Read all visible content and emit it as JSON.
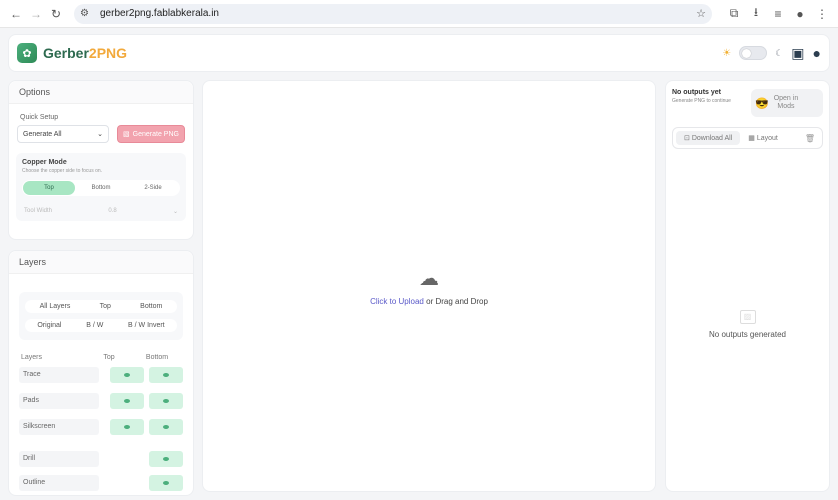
{
  "browser": {
    "url": "gerber2png.fablabkerala.in"
  },
  "app": {
    "brand_left": "Gerber",
    "brand_mid": "2",
    "brand_right": "PNG"
  },
  "options": {
    "title": "Options",
    "quick_setup_label": "Quick Setup",
    "quick_setup_value": "Generate All",
    "generate_btn": "Generate PNG",
    "copper_mode_title": "Copper Mode",
    "copper_mode_sub": "Choose the copper side to focus on.",
    "copper_tabs": [
      "Top",
      "Bottom",
      "2-Side"
    ],
    "tool_width_label": "Tool Width",
    "tool_width_value": "0.8"
  },
  "layers": {
    "title": "Layers",
    "filter_row1": [
      "All Layers",
      "Top",
      "Bottom"
    ],
    "filter_row2": [
      "Original",
      "B / W",
      "B / W Invert"
    ],
    "header": {
      "name": "Layers",
      "top": "Top",
      "bottom": "Bottom"
    },
    "rows": [
      {
        "name": "Trace"
      },
      {
        "name": "Pads"
      },
      {
        "name": "Silkscreen"
      },
      {
        "name": "Drill"
      },
      {
        "name": "Outline"
      }
    ]
  },
  "upload": {
    "link": "Click to Upload",
    "rest": " or Drag and Drop"
  },
  "outputs": {
    "title": "No outputs yet",
    "sub": "Generate PNG to continue",
    "mods_btn_line1": "Open in",
    "mods_btn_line2": "Mods",
    "download_all": "Download All",
    "layout": "Layout",
    "empty": "No outputs generated"
  }
}
